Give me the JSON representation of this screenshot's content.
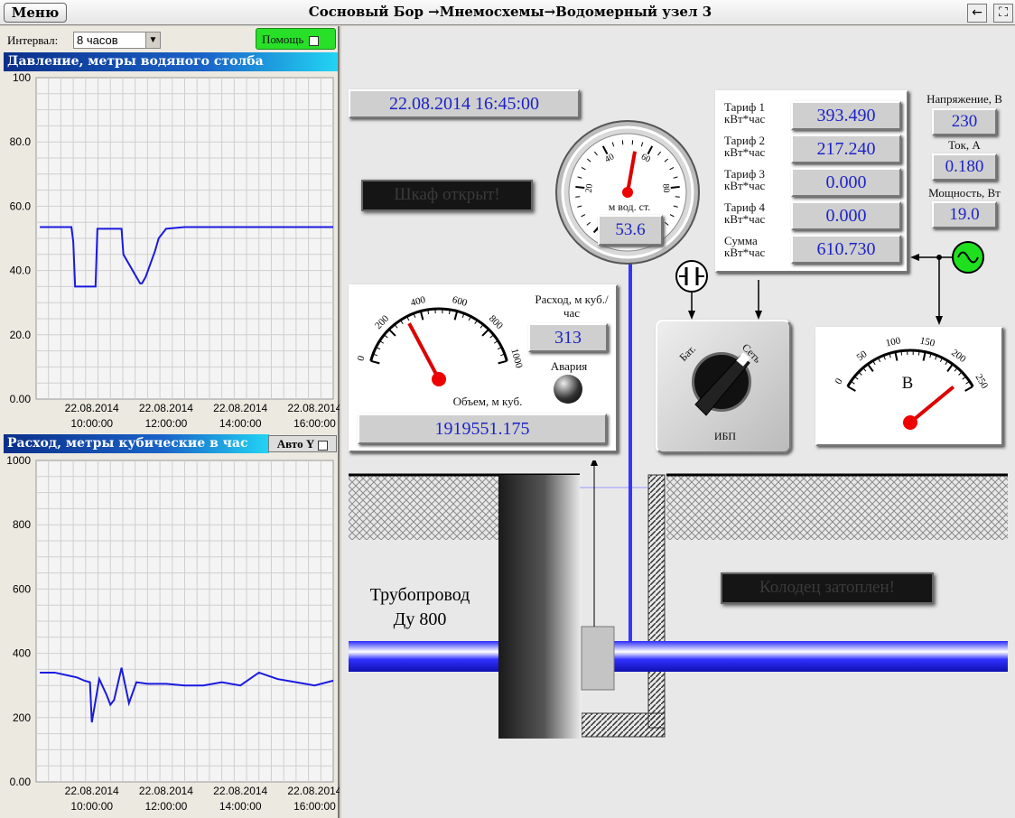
{
  "topbar": {
    "menu": "Меню",
    "title": "Сосновый Бор →Мнемосхемы→Водомерный узел 3",
    "back_icon": "←",
    "fullscreen_icon": "⛶"
  },
  "controls": {
    "interval_label": "Интервал:",
    "interval_value": "8 часов",
    "help": "Помощь",
    "autoy": "Авто Y"
  },
  "chart_data": [
    {
      "type": "line",
      "title": "Давление, метры водяного столба",
      "ylim": [
        0,
        100
      ],
      "yticks": [
        "0.00",
        "20.0",
        "40.0",
        "60.0",
        "80.0",
        "100"
      ],
      "xticks": [
        {
          "d": "22.08.2014",
          "t": "10:00:00"
        },
        {
          "d": "22.08.2014",
          "t": "12:00:00"
        },
        {
          "d": "22.08.2014",
          "t": "14:00:00"
        },
        {
          "d": "22.08.2014",
          "t": "16:00:00"
        }
      ],
      "series": [
        {
          "color": "#1a1ae0",
          "x": [
            8.6,
            9.1,
            9.45,
            9.5,
            9.55,
            10.0,
            10.1,
            10.15,
            10.5,
            10.8,
            10.85,
            11.3,
            11.35,
            11.45,
            11.7,
            11.8,
            12.0,
            12.5,
            13.0,
            14.0,
            15.0,
            16.0,
            16.5
          ],
          "values": [
            53.5,
            53.5,
            53.5,
            49,
            35,
            35,
            35,
            53,
            53,
            53,
            45,
            36,
            36,
            38,
            46,
            50,
            53,
            53.5,
            53.5,
            53.5,
            53.5,
            53.5,
            53.5
          ]
        }
      ]
    },
    {
      "type": "line",
      "title": "Расход, метры кубические в час",
      "ylim": [
        0,
        1000
      ],
      "yticks": [
        "0.00",
        "200",
        "400",
        "600",
        "800",
        "1000"
      ],
      "xticks": [
        {
          "d": "22.08.2014",
          "t": "10:00:00"
        },
        {
          "d": "22.08.2014",
          "t": "12:00:00"
        },
        {
          "d": "22.08.2014",
          "t": "14:00:00"
        },
        {
          "d": "22.08.2014",
          "t": "16:00:00"
        }
      ],
      "series": [
        {
          "color": "#1a1ae0",
          "x": [
            8.6,
            9.0,
            9.4,
            9.6,
            9.8,
            9.95,
            10.0,
            10.2,
            10.4,
            10.5,
            10.6,
            10.8,
            10.9,
            11.0,
            11.2,
            11.5,
            12.0,
            12.5,
            13.0,
            13.5,
            14.0,
            14.5,
            15.0,
            15.5,
            16.0,
            16.5
          ],
          "values": [
            340,
            340,
            330,
            325,
            315,
            310,
            185,
            320,
            270,
            240,
            255,
            355,
            300,
            245,
            310,
            305,
            305,
            300,
            300,
            310,
            300,
            340,
            320,
            310,
            300,
            315
          ]
        }
      ]
    }
  ],
  "datetime": "22.08.2014 16:45:00",
  "cabinet": "Шкаф открыт!",
  "well_flooded": "Колодец затоплен!",
  "pressure_gauge": {
    "value": "53.6",
    "label": "м вод. ст.",
    "ticks": [
      "0",
      "20",
      "40",
      "60",
      "80",
      "100"
    ],
    "reading": 53.6
  },
  "flow_gauge": {
    "ticks": [
      "0",
      "200",
      "400",
      "600",
      "800",
      "1000"
    ],
    "reading": 313,
    "label": "Расход, м куб./час",
    "value": "313",
    "alarm": "Авария",
    "volume_label": "Объем, м куб.",
    "volume": "1919551.175"
  },
  "tariffs": [
    {
      "name": "Тариф 1",
      "unit": "кВт*час",
      "value": "393.490"
    },
    {
      "name": "Тариф 2",
      "unit": "кВт*час",
      "value": "217.240"
    },
    {
      "name": "Тариф 3",
      "unit": "кВт*час",
      "value": "0.000"
    },
    {
      "name": "Тариф 4",
      "unit": "кВт*час",
      "value": "0.000"
    },
    {
      "name": "Сумма",
      "unit": "кВт*час",
      "value": "610.730"
    }
  ],
  "power": {
    "voltage_label": "Напряжение, В",
    "voltage": "230",
    "current_label": "Ток, А",
    "current": "0.180",
    "power_label": "Мощность, Вт",
    "power": "19.0"
  },
  "ups": {
    "bat": "Бат.",
    "net": "Сеть",
    "label": "ИБП"
  },
  "volt_gauge": {
    "ticks": [
      "0",
      "50",
      "100",
      "150",
      "200",
      "250"
    ],
    "unit": "В",
    "reading": 230
  },
  "pipe": {
    "line1": "Трубопровод",
    "line2": "Ду 800"
  }
}
